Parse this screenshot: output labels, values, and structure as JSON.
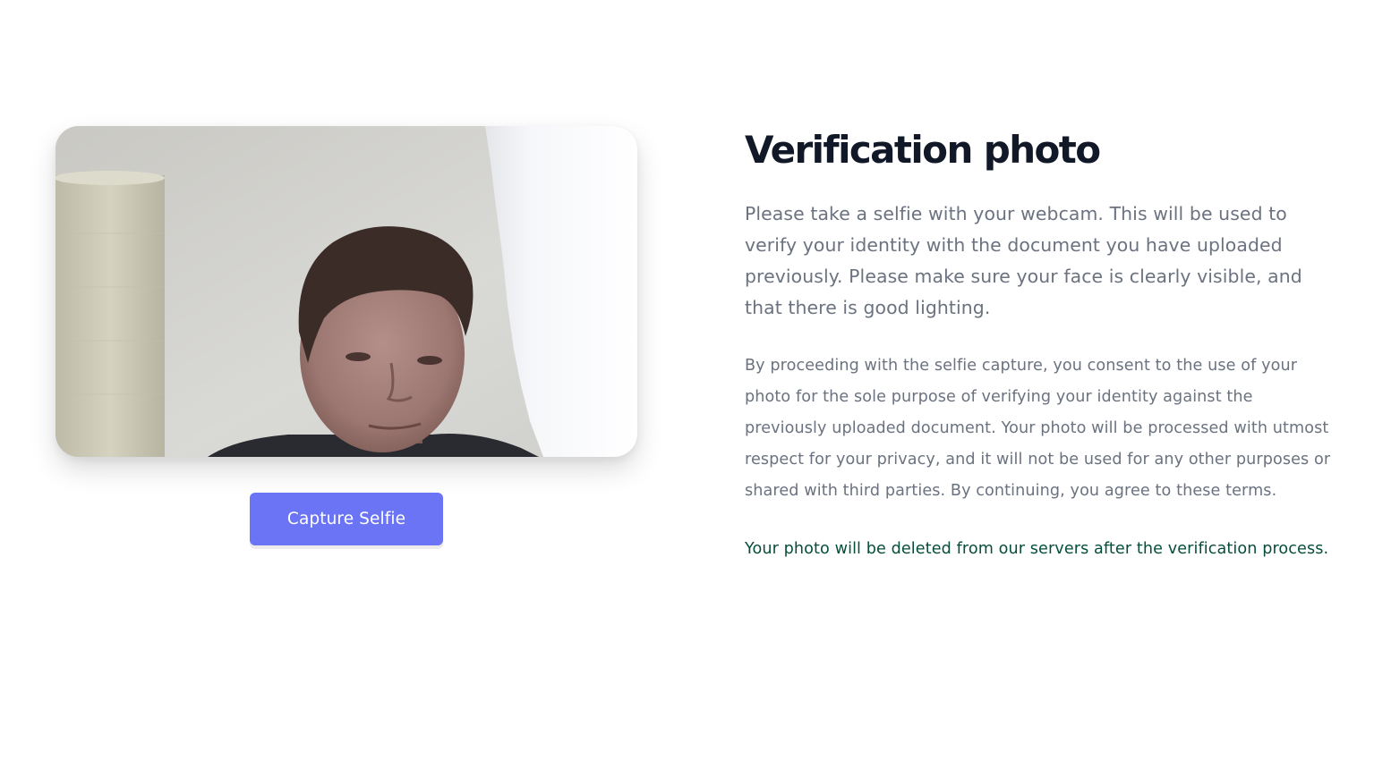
{
  "webcam": {
    "preview_label": "webcam preview"
  },
  "capture_button": {
    "label": "Capture Selfie"
  },
  "content": {
    "title": "Verification photo",
    "intro": "Please take a selfie with your webcam. This will be used to verify your identity with the document you have uploaded previously. Please make sure your face is clearly visible, and that there is good lighting.",
    "consent": "By proceeding with the selfie capture, you consent to the use of your photo for the sole purpose of verifying your identity against the previously uploaded document. Your photo will be processed with utmost respect for your privacy, and it will not be used for any other purposes or shared with third parties. By continuing, you agree to these terms.",
    "deletion_note": "Your photo will be deleted from our servers after the verification process."
  },
  "colors": {
    "button_bg": "#6b74f5",
    "title": "#111827",
    "body_text": "#6b7280",
    "note_text": "#064e3b"
  }
}
